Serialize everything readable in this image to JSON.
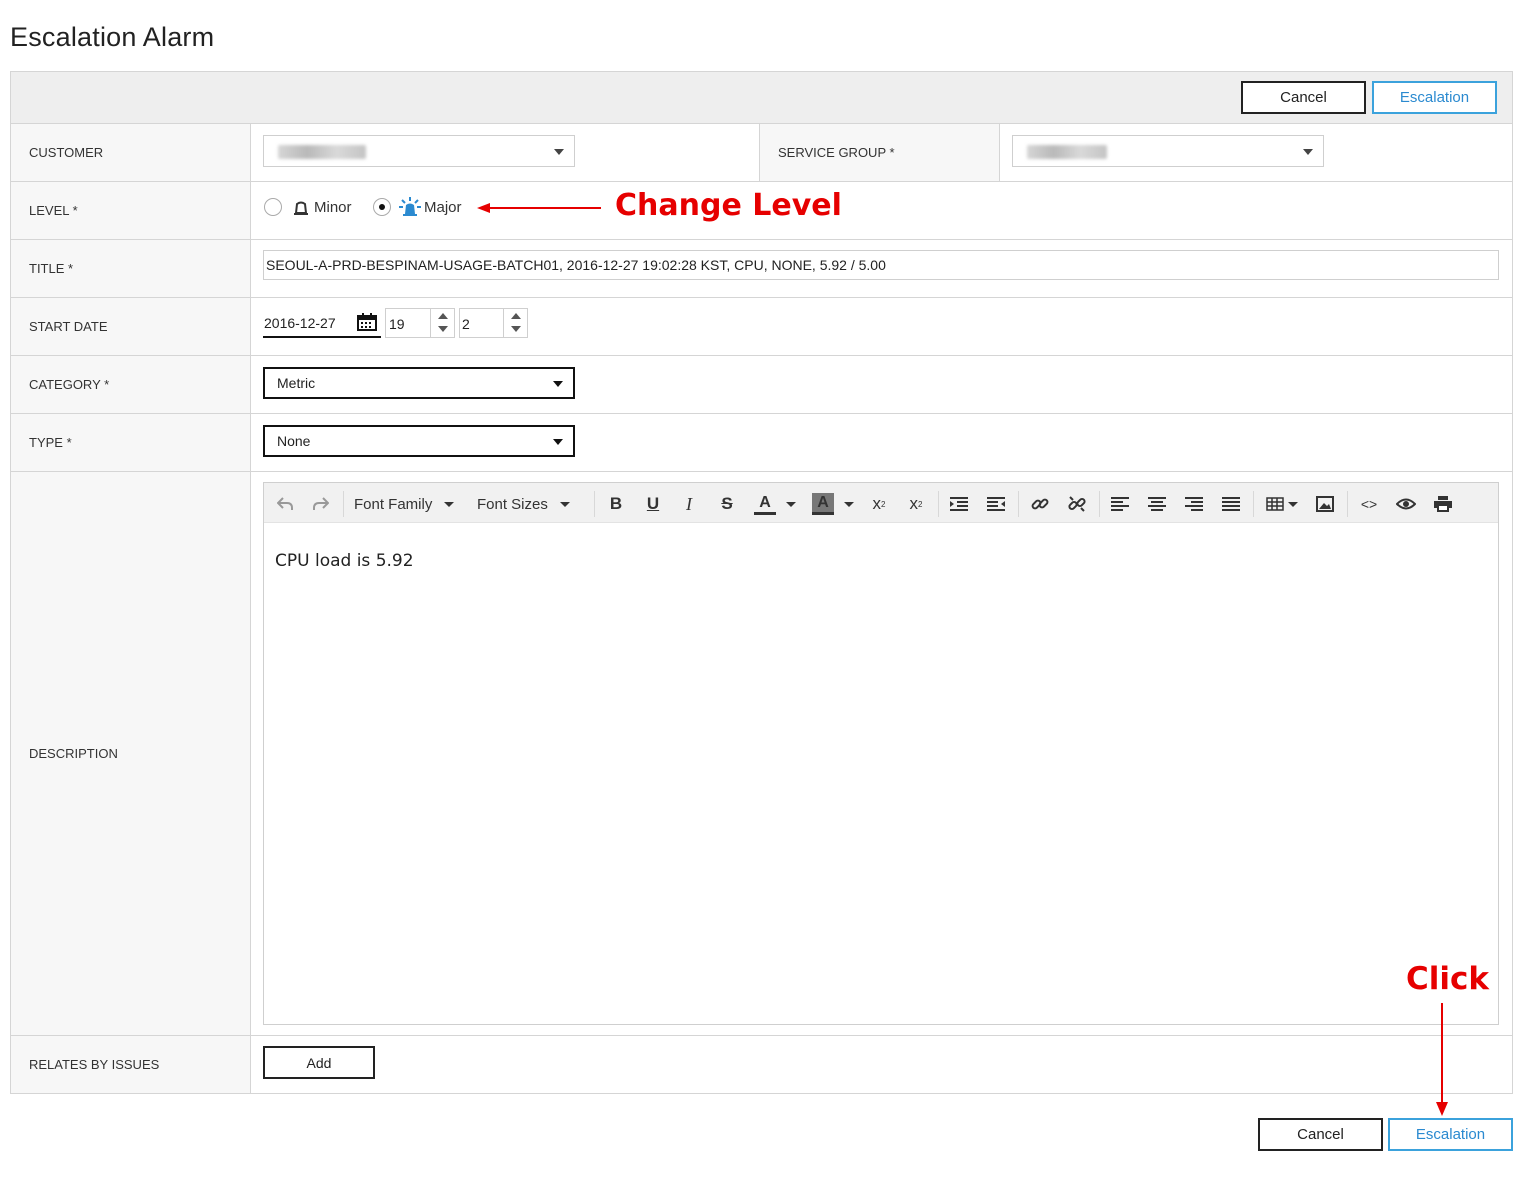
{
  "page": {
    "title": "Escalation Alarm"
  },
  "actions": {
    "cancel_label": "Cancel",
    "escalation_label": "Escalation"
  },
  "fields": {
    "customer": {
      "label": "CUSTOMER"
    },
    "service_group": {
      "label": "SERVICE GROUP *"
    },
    "level": {
      "label": "LEVEL *",
      "options": [
        "Minor",
        "Major"
      ],
      "selected": "Major"
    },
    "title": {
      "label": "TITLE *",
      "value": "SEOUL-A-PRD-BESPINAM-USAGE-BATCH01, 2016-12-27 19:02:28 KST, CPU, NONE, 5.92 / 5.00"
    },
    "start_date": {
      "label": "START DATE",
      "date": "2016-12-27",
      "hour": "19",
      "minute": "2"
    },
    "category": {
      "label": "CATEGORY *",
      "value": "Metric"
    },
    "type": {
      "label": "TYPE *",
      "value": "None"
    },
    "description": {
      "label": "DESCRIPTION",
      "content": "CPU load is 5.92"
    },
    "relates": {
      "label": "RELATES BY ISSUES",
      "add_label": "Add"
    }
  },
  "editor_toolbar": {
    "font_family": "Font Family",
    "font_sizes": "Font Sizes",
    "icons": [
      "undo-icon",
      "redo-icon",
      "bold-icon",
      "underline-icon",
      "italic-icon",
      "strikethrough-icon",
      "text-color-icon",
      "background-color-icon",
      "superscript-icon",
      "subscript-icon",
      "indent-icon",
      "outdent-icon",
      "link-icon",
      "unlink-icon",
      "align-left-icon",
      "align-center-icon",
      "align-right-icon",
      "align-justify-icon",
      "table-icon",
      "image-icon",
      "code-icon",
      "preview-icon",
      "print-icon"
    ]
  },
  "annotations": {
    "change_level": "Change Level",
    "click": "Click",
    "color": "#e60000"
  },
  "colors": {
    "accent": "#3ba2dc",
    "header_bg": "#eeeeee",
    "label_bg": "#f7f7f7"
  }
}
